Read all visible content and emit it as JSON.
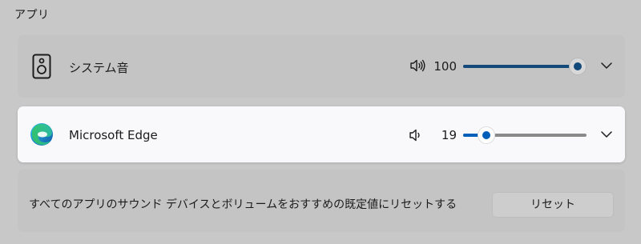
{
  "section_title": "アプリ",
  "apps": [
    {
      "name": "システム音",
      "icon": "speaker-device-icon",
      "volume": 100,
      "volume_icon": "speaker-volume-high-icon"
    },
    {
      "name": "Microsoft Edge",
      "icon": "microsoft-edge-icon",
      "volume": 19,
      "volume_icon": "speaker-volume-low-icon"
    }
  ],
  "reset": {
    "text": "すべてのアプリのサウンド デバイスとボリュームをおすすめの既定値にリセットする",
    "button_label": "リセット"
  },
  "colors": {
    "accent": "#005fb8",
    "accent_dimmed": "#144a7a"
  }
}
